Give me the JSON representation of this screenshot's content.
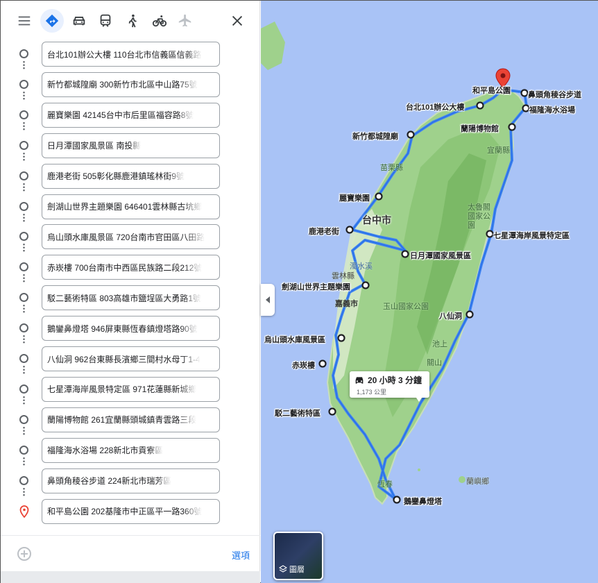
{
  "travel_modes": [
    {
      "name": "menu-icon"
    },
    {
      "name": "best-route-icon",
      "active": true
    },
    {
      "name": "car-icon"
    },
    {
      "name": "transit-icon"
    },
    {
      "name": "walking-icon"
    },
    {
      "name": "cycling-icon"
    },
    {
      "name": "flight-icon"
    },
    {
      "name": "close-icon"
    }
  ],
  "stops": [
    "台北101辦公大樓 110台北市信義區信義路",
    "新竹都城隍廟 300新竹市北區中山路75號",
    "麗寶樂園 42145台中市后里區福容路8號",
    "日月潭國家風景區 南投縣",
    "鹿港老街 505彰化縣鹿港鎮瑤林街9號",
    "劍湖山世界主題樂園 646401雲林縣古坑鄉",
    "烏山頭水庫風景區 720台南市官田區八田路",
    "赤崁樓 700台南市中西區民族路二段212號",
    "駁二藝術特區 803高雄市鹽埕區大勇路1號",
    "鵝鑾鼻燈塔 946屏東縣恆春鎮燈塔路90號",
    "八仙洞 962台東縣長濱鄉三間村水母丁1-4",
    "七星潭海岸風景特定區 971花蓮縣新城鄉",
    "蘭陽博物館 261宜蘭縣頭城鎮青雲路三段",
    "福隆海水浴場 228新北市貢寮區",
    "鼻頭角稜谷步道 224新北市瑞芳區",
    "和平島公園 202基隆市中正區平一路360號"
  ],
  "footer": {
    "options_label": "選項"
  },
  "map": {
    "route_time": "20 小時 3 分鐘",
    "route_distance": "1,173 公里",
    "layers_label": "圖層",
    "places": [
      {
        "label": "和平島公園"
      },
      {
        "label": "鼻頭角稜谷步道"
      },
      {
        "label": "台北101辦公大樓"
      },
      {
        "label": "福隆海水浴場"
      },
      {
        "label": "蘭陽博物館"
      },
      {
        "label": "新竹都城隍廟"
      },
      {
        "label": "麗寶樂園"
      },
      {
        "label": "鹿港老街"
      },
      {
        "label": "七星潭海岸風景特定區"
      },
      {
        "label": "日月潭國家風景區"
      },
      {
        "label": "劍湖山世界主題樂園"
      },
      {
        "label": "八仙洞"
      },
      {
        "label": "烏山頭水庫風景區"
      },
      {
        "label": "赤崁樓"
      },
      {
        "label": "駁二藝術特區"
      },
      {
        "label": "鵝鑾鼻燈塔"
      }
    ],
    "region_labels": [
      {
        "label": "台中市"
      },
      {
        "label": "嘉義市"
      },
      {
        "label": "宜蘭縣"
      },
      {
        "label": "苗栗縣"
      },
      {
        "label": "太魯閣國家公園"
      },
      {
        "label": "雲林縣"
      },
      {
        "label": "濁水溪"
      },
      {
        "label": "玉山國家公園"
      },
      {
        "label": "池上"
      },
      {
        "label": "關山"
      },
      {
        "label": "恆春"
      },
      {
        "label": "蘭嶼鄉"
      }
    ]
  }
}
